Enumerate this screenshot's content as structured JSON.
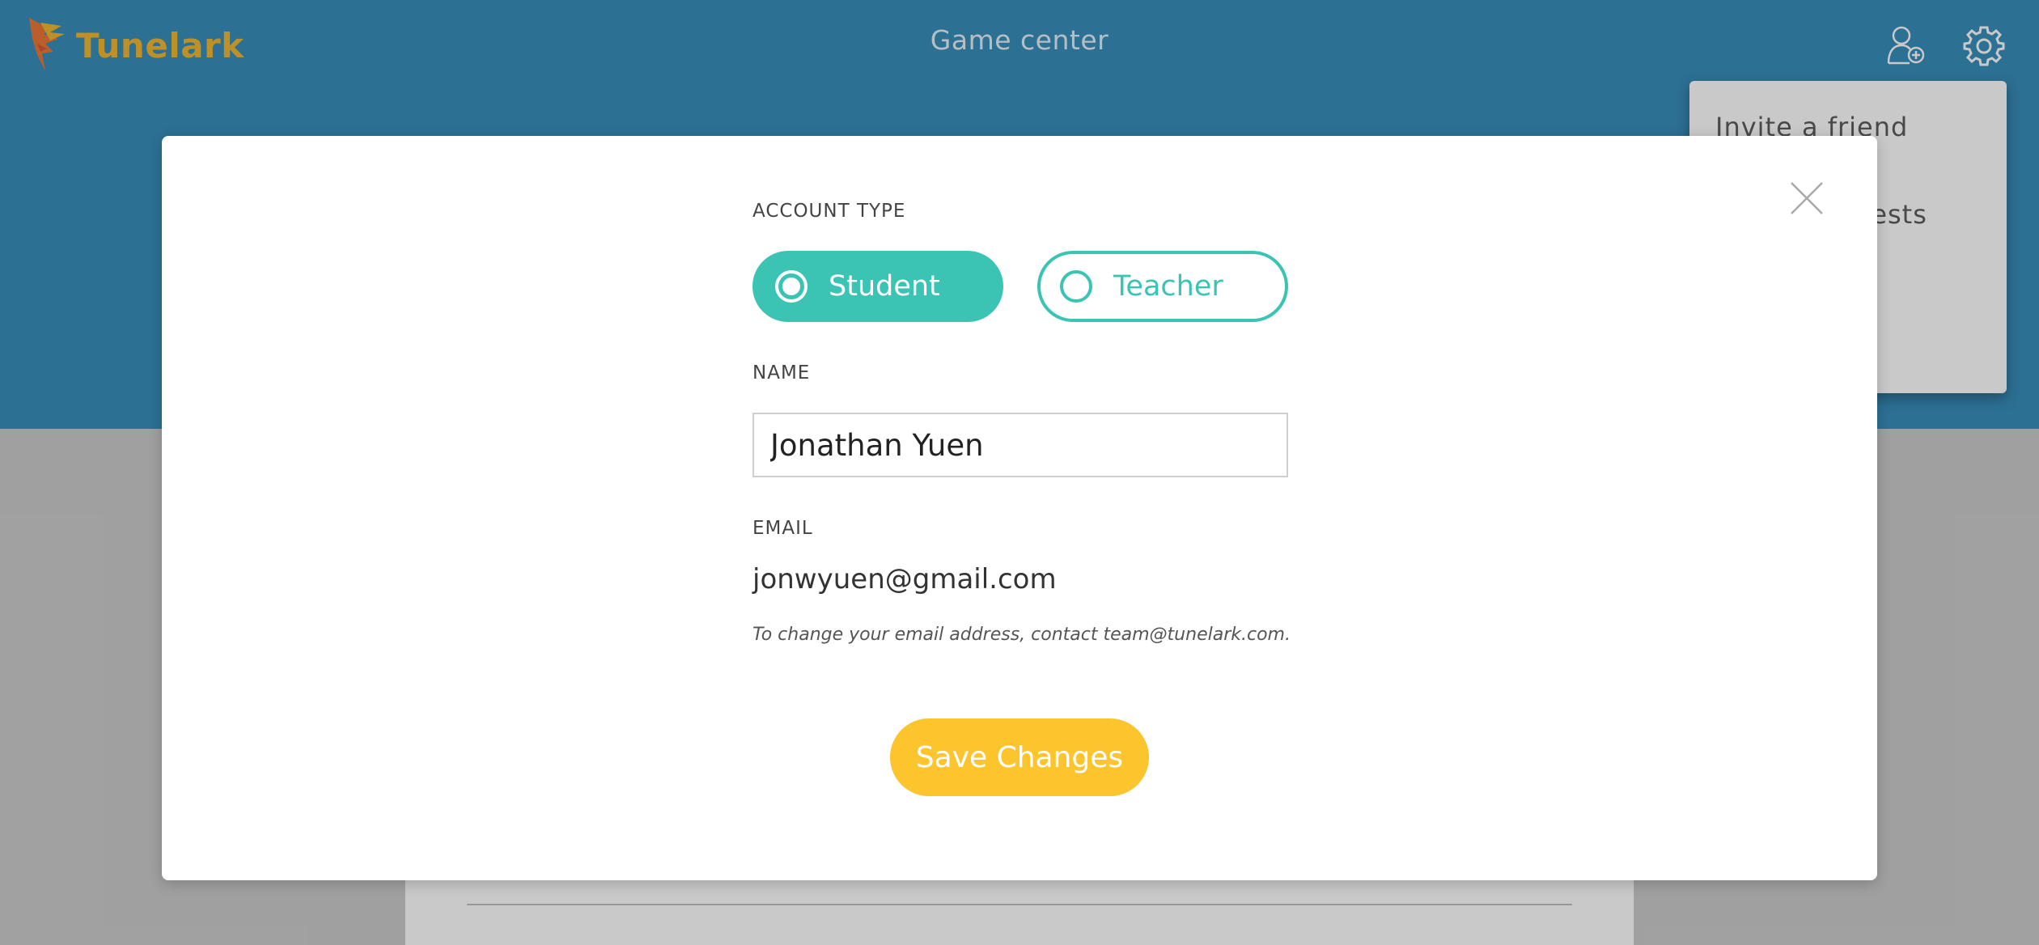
{
  "header": {
    "brand": "Tunelark",
    "title": "Game center",
    "icons": [
      "add-friend-icon",
      "gear-icon"
    ],
    "color": "#2e88b8",
    "brand_color": "#f0b429"
  },
  "settings_menu": {
    "items": [
      "Invite a friend",
      "Friend requests"
    ]
  },
  "modal": {
    "account_type_label": "ACCOUNT TYPE",
    "options": [
      {
        "label": "Student",
        "selected": true
      },
      {
        "label": "Teacher",
        "selected": false
      }
    ],
    "name_label": "NAME",
    "name_value": "Jonathan Yuen",
    "email_label": "EMAIL",
    "email_value": "jonwyuen@gmail.com",
    "email_note": "To change your email address, contact team@tunelark.com.",
    "save_label": "Save Changes",
    "accent_color": "#3bc4b3",
    "save_color": "#fcc42d"
  }
}
